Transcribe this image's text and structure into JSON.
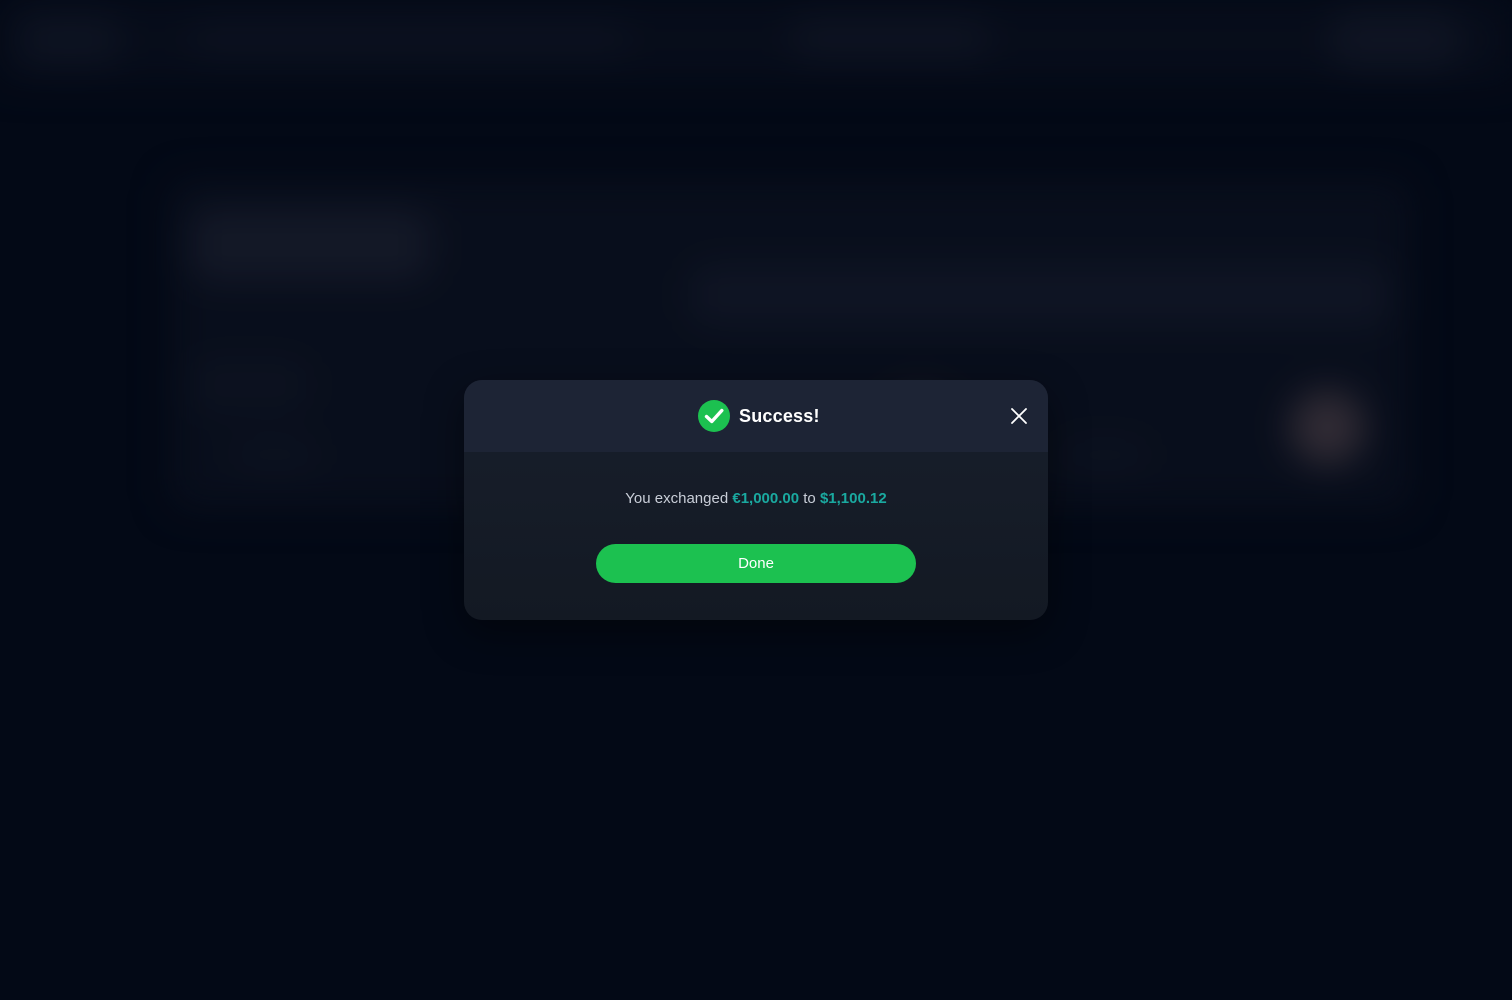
{
  "modal": {
    "title": "Success!",
    "message": {
      "prefix": "You exchanged",
      "from_amount": "€1,000.00",
      "connector": "to",
      "to_amount": "$1,100.12"
    },
    "done_label": "Done",
    "icons": {
      "status": "check-circle-icon",
      "close": "close-icon"
    }
  },
  "colors": {
    "page_background": "#040b19",
    "modal_background": "#161c27",
    "modal_header": "#1d2435",
    "success_green": "#1cc150",
    "amount_teal": "#1aa9a0",
    "title_text": "#ffffff",
    "body_text": "#c9ced8"
  }
}
